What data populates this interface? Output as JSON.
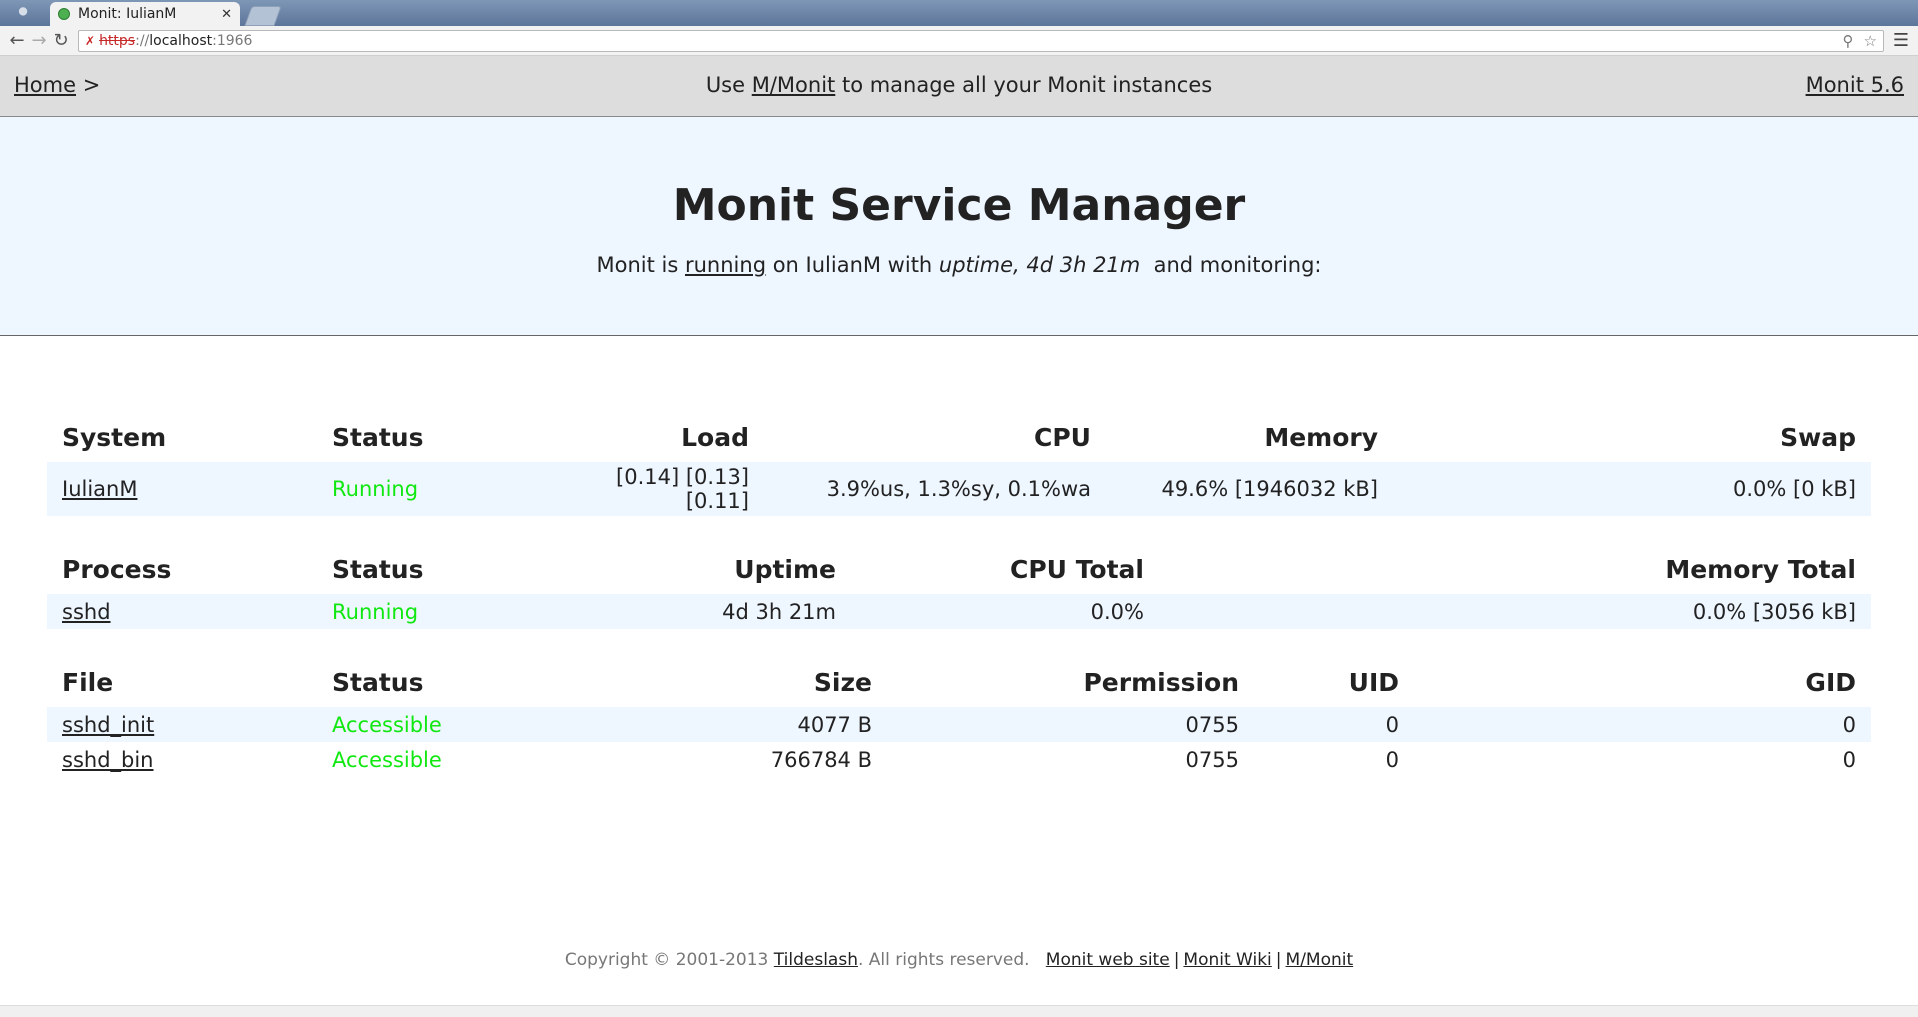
{
  "browser": {
    "tab_title": "Monit: IulianM",
    "url_scheme": "https",
    "url_sep": "://",
    "url_host": "localhost",
    "url_port": ":1966"
  },
  "nav": {
    "home": "Home",
    "home_arrow": ">",
    "center_pre": "Use ",
    "center_link": "M/Monit",
    "center_post": " to manage all your Monit instances",
    "version": "Monit 5.6"
  },
  "banner": {
    "title": "Monit Service Manager",
    "pre": "Monit is ",
    "status_link": "running",
    "mid": " on IulianM with ",
    "uptime": "uptime, 4d 3h 21m",
    "post": "  and monitoring:"
  },
  "system_table": {
    "headers": [
      "System",
      "Status",
      "Load",
      "CPU",
      "Memory",
      "Swap"
    ],
    "rows": [
      {
        "name": "IulianM",
        "status": "Running",
        "load": "[0.14] [0.13] [0.11]",
        "cpu": "3.9%us, 1.3%sy, 0.1%wa",
        "memory": "49.6% [1946032 kB]",
        "swap": "0.0% [0 kB]"
      }
    ]
  },
  "process_table": {
    "headers": [
      "Process",
      "Status",
      "Uptime",
      "CPU Total",
      "Memory Total"
    ],
    "rows": [
      {
        "name": "sshd",
        "status": "Running",
        "uptime": "4d 3h 21m",
        "cpu_total": "0.0%",
        "memory_total": "0.0% [3056 kB]"
      }
    ]
  },
  "file_table": {
    "headers": [
      "File",
      "Status",
      "Size",
      "Permission",
      "UID",
      "GID"
    ],
    "rows": [
      {
        "name": "sshd_init",
        "status": "Accessible",
        "size": "4077 B",
        "permission": "0755",
        "uid": "0",
        "gid": "0"
      },
      {
        "name": "sshd_bin",
        "status": "Accessible",
        "size": "766784 B",
        "permission": "0755",
        "uid": "0",
        "gid": "0"
      }
    ]
  },
  "footer": {
    "copyright": "Copyright © 2001-2013 ",
    "company": "Tildeslash",
    "rights": ". All rights reserved.  ",
    "link1": "Monit web site",
    "link2": "Monit Wiki",
    "link3": "M/Monit",
    "sep": "|"
  },
  "colors": {
    "status_ok": "#11e811",
    "banner_bg": "#eef6ff",
    "nav_bg": "#dddddd"
  }
}
